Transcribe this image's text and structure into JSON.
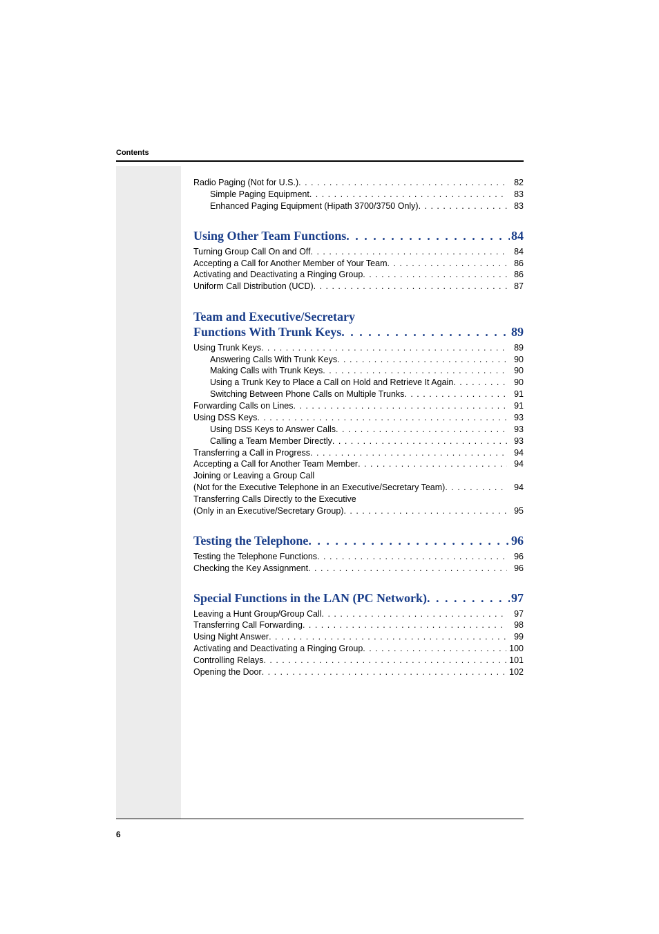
{
  "header": {
    "label": "Contents"
  },
  "footer": {
    "page_num": "6"
  },
  "pre_entries": [
    {
      "label": "Radio Paging (Not for U.S.)",
      "page": "82",
      "indent": 0
    },
    {
      "label": "Simple Paging Equipment",
      "page": "83",
      "indent": 1
    },
    {
      "label": "Enhanced Paging Equipment (Hipath 3700/3750 Only)",
      "page": "83",
      "indent": 1
    }
  ],
  "sections": [
    {
      "title": "Using Other Team Functions",
      "page": "84",
      "entries": [
        {
          "label": "Turning Group Call On and Off",
          "page": "84",
          "indent": 0
        },
        {
          "label": "Accepting a Call for Another Member of Your Team",
          "page": "86",
          "indent": 0
        },
        {
          "label": "Activating and Deactivating a Ringing Group",
          "page": "86",
          "indent": 0
        },
        {
          "label": "Uniform Call Distribution (UCD)",
          "page": "87",
          "indent": 0
        }
      ]
    },
    {
      "title_line1": "Team and Executive/Secretary",
      "title_line2": "Functions With Trunk Keys",
      "page": "89",
      "entries": [
        {
          "label": "Using Trunk Keys",
          "page": "89",
          "indent": 0
        },
        {
          "label": "Answering Calls With Trunk Keys",
          "page": "90",
          "indent": 1
        },
        {
          "label": "Making Calls with Trunk Keys",
          "page": "90",
          "indent": 1
        },
        {
          "label": "Using a Trunk Key to Place a Call on Hold and Retrieve It Again",
          "page": "90",
          "indent": 1
        },
        {
          "label": "Switching Between Phone Calls on Multiple Trunks",
          "page": "91",
          "indent": 1
        },
        {
          "label": "Forwarding Calls on Lines",
          "page": "91",
          "indent": 0
        },
        {
          "label": "Using DSS Keys",
          "page": "93",
          "indent": 0
        },
        {
          "label": "Using DSS Keys to Answer Calls",
          "page": "93",
          "indent": 1
        },
        {
          "label": "Calling a Team Member Directly",
          "page": "93",
          "indent": 1
        },
        {
          "label": "Transferring a Call in Progress",
          "page": "94",
          "indent": 0
        },
        {
          "label": "Accepting a Call for Another Team Member",
          "page": "94",
          "indent": 0
        },
        {
          "label_nodots": "Joining or Leaving a Group Call",
          "indent": 0
        },
        {
          "label": "(Not for the Executive Telephone in an Executive/Secretary Team)",
          "page": "94",
          "indent": 0
        },
        {
          "label_nodots": "Transferring Calls Directly to the Executive",
          "indent": 0
        },
        {
          "label": "(Only in an Executive/Secretary Group)",
          "page": "95",
          "indent": 0
        }
      ]
    },
    {
      "title": "Testing the Telephone",
      "page": "96",
      "entries": [
        {
          "label": "Testing the Telephone Functions",
          "page": "96",
          "indent": 0
        },
        {
          "label": "Checking the Key Assignment",
          "page": "96",
          "indent": 0
        }
      ]
    },
    {
      "title": "Special Functions in the LAN (PC Network)",
      "page": "97",
      "entries": [
        {
          "label": "Leaving a Hunt Group/Group Call",
          "page": "97",
          "indent": 0
        },
        {
          "label": "Transferring Call Forwarding",
          "page": "98",
          "indent": 0
        },
        {
          "label": "Using Night Answer",
          "page": "99",
          "indent": 0
        },
        {
          "label": "Activating and Deactivating a Ringing Group",
          "page": "100",
          "indent": 0
        },
        {
          "label": "Controlling Relays",
          "page": "101",
          "indent": 0
        },
        {
          "label": "Opening the Door",
          "page": "102",
          "indent": 0
        }
      ]
    }
  ]
}
